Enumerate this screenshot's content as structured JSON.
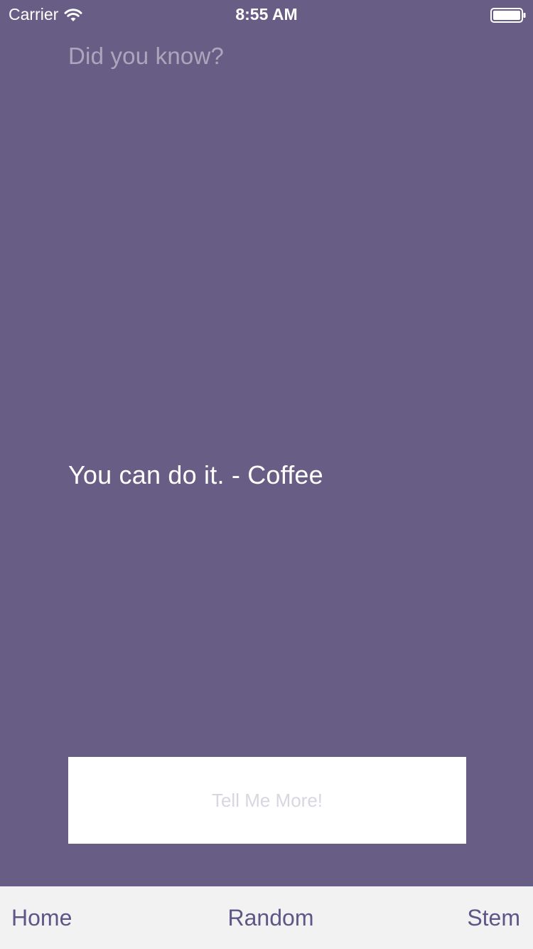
{
  "status_bar": {
    "carrier": "Carrier",
    "time": "8:55 AM",
    "wifi_icon": "wifi-icon",
    "battery_icon": "battery-icon"
  },
  "header": {
    "title": "Did you know?"
  },
  "fact": {
    "text": "You can do it. - Coffee"
  },
  "action": {
    "button_label": "Tell Me More!"
  },
  "tab_bar": {
    "items": [
      {
        "label": "Home"
      },
      {
        "label": "Random"
      },
      {
        "label": "Stem"
      }
    ]
  },
  "colors": {
    "background": "#685e85",
    "tab_bar_background": "#f2f2f2",
    "tab_text": "#5e5687",
    "button_background": "#ffffff",
    "button_text": "#d9d6e1"
  }
}
